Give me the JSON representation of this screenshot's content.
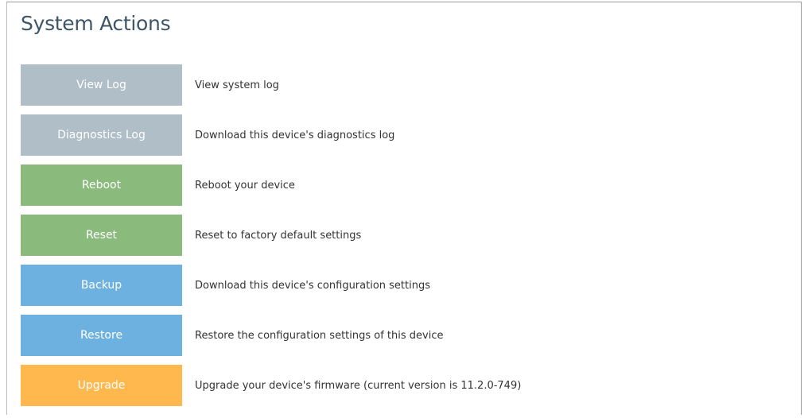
{
  "page": {
    "title": "System Actions"
  },
  "colors": {
    "title": "#3e5566",
    "gray": "#b0bec7",
    "green": "#8aba7c",
    "blue": "#6db1e0",
    "orange": "#ffb84d"
  },
  "actions": [
    {
      "label": "View Log",
      "description": "View system log",
      "color": "#b0bec7"
    },
    {
      "label": "Diagnostics Log",
      "description": "Download this device's diagnostics log",
      "color": "#b0bec7"
    },
    {
      "label": "Reboot",
      "description": "Reboot your device",
      "color": "#8aba7c"
    },
    {
      "label": "Reset",
      "description": "Reset to factory default settings",
      "color": "#8aba7c"
    },
    {
      "label": "Backup",
      "description": "Download this device's configuration settings",
      "color": "#6db1e0"
    },
    {
      "label": "Restore",
      "description": "Restore the configuration settings of this device",
      "color": "#6db1e0"
    },
    {
      "label": "Upgrade",
      "description": "Upgrade your device's firmware (current version is 11.2.0-749)",
      "color": "#ffb84d"
    }
  ]
}
